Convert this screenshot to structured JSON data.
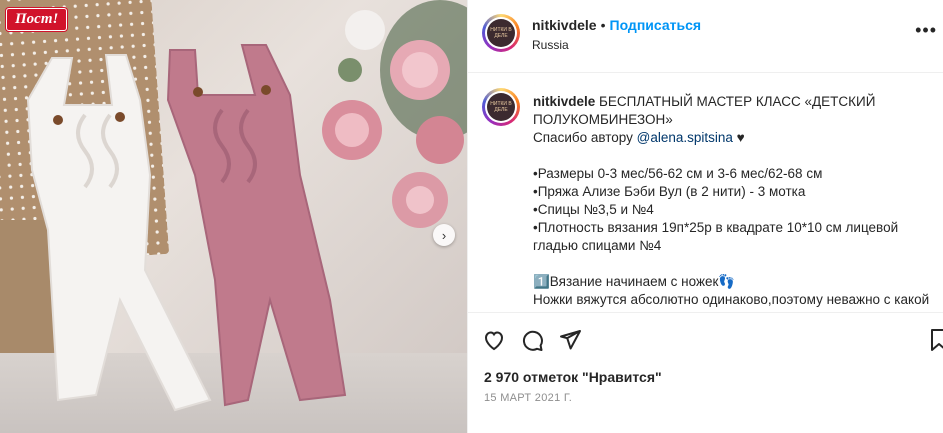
{
  "photo": {
    "badge": "Пост!",
    "next_arrow": "›"
  },
  "post": {
    "author": {
      "username": "nitkivdele",
      "dot": "•",
      "follow_label": "Подписаться",
      "location": "Russia",
      "avatar_text": "НИТКИ В ДЕЛЕ"
    },
    "more_icon": "•••",
    "caption": {
      "username": "nitkivdele",
      "lines": [
        " БЕСПЛАТНЫЙ МАСТЕР КЛАСС «ДЕТСКИЙ",
        "ПОЛУКОМБИНЕЗОН»",
        "",
        "",
        "•Размеры 0-3 мес/56-62 см и 3-6 мес/62-68 см",
        "•Пряжа Ализе Бэби Вул (в 2 нити) - 3 мотка",
        "•Спицы №3,5 и №4",
        "•Плотность вязания 19п*25р в квадрате 10*10 см лицевой",
        "гладью спицами №4",
        "",
        "1️⃣Вязание начинаем с ножек👣",
        "Ножки вяжутся абсолютно одинаково,поэтому неважно с какой"
      ],
      "thanks_prefix": "Спасибо автору ",
      "mention": "@alena.spitsina",
      "thanks_suffix": " ♥"
    },
    "likes_label": "2 970 отметок \"Нравится\"",
    "date_label": "15 МАРТ 2021 Г."
  },
  "icons": {
    "like": "heart-icon",
    "comment": "comment-icon",
    "share": "paper-plane-icon",
    "save": "bookmark-icon"
  },
  "colors": {
    "follow": "#0095f6",
    "badge": "#d1132b",
    "overall_pink": "#c07a8c",
    "overall_white": "#f5f3f1"
  }
}
